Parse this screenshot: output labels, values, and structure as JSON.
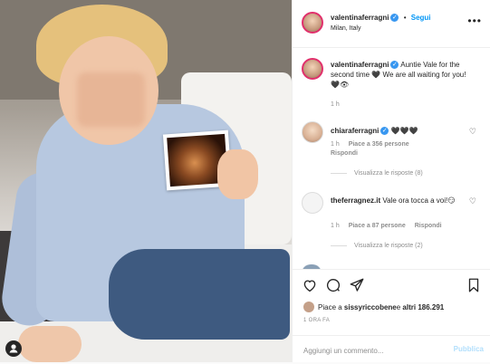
{
  "post": {
    "user_tag_icon": "person-icon",
    "username": "valentinaferragni",
    "follow_label": "Segui",
    "separator": "•",
    "location": "Milan, Italy",
    "more_icon": "more-horizontal-icon"
  },
  "caption": {
    "username": "valentinaferragni",
    "text": "Auntie Vale for the second time 🖤 We are all waiting for you! 🖤👁",
    "time": "1 h"
  },
  "comments": [
    {
      "username": "chiaraferragni",
      "text": "🖤🖤🖤",
      "time": "1 h",
      "likes": "Piace a 356 persone",
      "reply": "Rispondi",
      "view_replies": "Visualizza le risposte (8)"
    },
    {
      "username": "theferragnez.it",
      "text": "Vale ora tocca a voi!😏",
      "time": "1 h",
      "likes": "Piace a 87 persone",
      "reply": "Rispondi",
      "view_replies": "Visualizza le risposte (2)"
    }
  ],
  "actions": {
    "liked_by_prefix": "Piace a ",
    "liked_by_user": "sissyriccobene",
    "liked_by_middle": " e ",
    "liked_by_others": "altri 186.291",
    "time_ago": "1 ORA FA",
    "comment_placeholder": "Aggiungi un commento...",
    "publish_label": "Pubblica"
  },
  "colors": {
    "accent": "#0095f6",
    "verified": "#3897f0",
    "publish_disabled": "#b2dffc"
  }
}
